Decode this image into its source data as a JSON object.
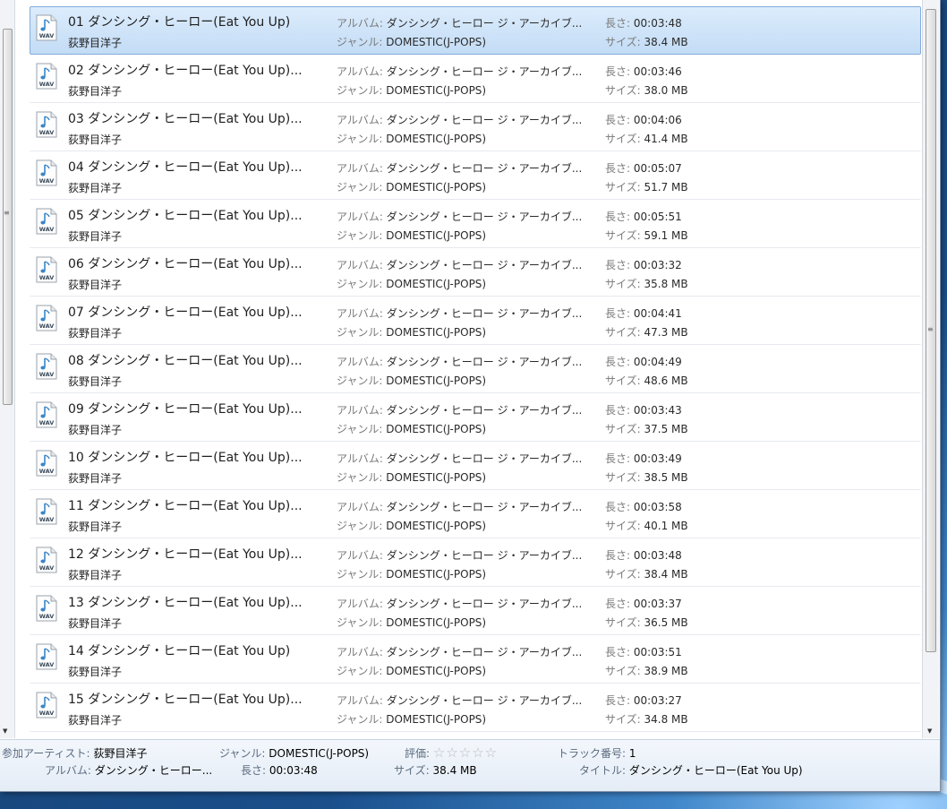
{
  "labels": {
    "album": "アルバム:",
    "genre": "ジャンル:",
    "length": "長さ:",
    "size": "サイズ:"
  },
  "file_icon_text": "WAV",
  "tracks": [
    {
      "title": "01 ダンシング・ヒーロー(Eat You Up)",
      "artist": "荻野目洋子",
      "album": "ダンシング・ヒーロー ジ・アーカイブ...",
      "genre": "DOMESTIC(J-POPS)",
      "length": "00:03:48",
      "size": "38.4 MB",
      "selected": true
    },
    {
      "title": "02 ダンシング・ヒーロー(Eat You Up)...",
      "artist": "荻野目洋子",
      "album": "ダンシング・ヒーロー ジ・アーカイブ...",
      "genre": "DOMESTIC(J-POPS)",
      "length": "00:03:46",
      "size": "38.0 MB"
    },
    {
      "title": "03 ダンシング・ヒーロー(Eat You Up)...",
      "artist": "荻野目洋子",
      "album": "ダンシング・ヒーロー ジ・アーカイブ...",
      "genre": "DOMESTIC(J-POPS)",
      "length": "00:04:06",
      "size": "41.4 MB"
    },
    {
      "title": "04 ダンシング・ヒーロー(Eat You Up)...",
      "artist": "荻野目洋子",
      "album": "ダンシング・ヒーロー ジ・アーカイブ...",
      "genre": "DOMESTIC(J-POPS)",
      "length": "00:05:07",
      "size": "51.7 MB"
    },
    {
      "title": "05 ダンシング・ヒーロー(Eat You Up)...",
      "artist": "荻野目洋子",
      "album": "ダンシング・ヒーロー ジ・アーカイブ...",
      "genre": "DOMESTIC(J-POPS)",
      "length": "00:05:51",
      "size": "59.1 MB"
    },
    {
      "title": "06 ダンシング・ヒーロー(Eat You Up)...",
      "artist": "荻野目洋子",
      "album": "ダンシング・ヒーロー ジ・アーカイブ...",
      "genre": "DOMESTIC(J-POPS)",
      "length": "00:03:32",
      "size": "35.8 MB"
    },
    {
      "title": "07 ダンシング・ヒーロー(Eat You Up)...",
      "artist": "荻野目洋子",
      "album": "ダンシング・ヒーロー ジ・アーカイブ...",
      "genre": "DOMESTIC(J-POPS)",
      "length": "00:04:41",
      "size": "47.3 MB"
    },
    {
      "title": "08 ダンシング・ヒーロー(Eat You Up)...",
      "artist": "荻野目洋子",
      "album": "ダンシング・ヒーロー ジ・アーカイブ...",
      "genre": "DOMESTIC(J-POPS)",
      "length": "00:04:49",
      "size": "48.6 MB"
    },
    {
      "title": "09 ダンシング・ヒーロー(Eat You Up)...",
      "artist": "荻野目洋子",
      "album": "ダンシング・ヒーロー ジ・アーカイブ...",
      "genre": "DOMESTIC(J-POPS)",
      "length": "00:03:43",
      "size": "37.5 MB"
    },
    {
      "title": "10 ダンシング・ヒーロー(Eat You Up)...",
      "artist": "荻野目洋子",
      "album": "ダンシング・ヒーロー ジ・アーカイブ...",
      "genre": "DOMESTIC(J-POPS)",
      "length": "00:03:49",
      "size": "38.5 MB"
    },
    {
      "title": "11 ダンシング・ヒーロー(Eat You Up)...",
      "artist": "荻野目洋子",
      "album": "ダンシング・ヒーロー ジ・アーカイブ...",
      "genre": "DOMESTIC(J-POPS)",
      "length": "00:03:58",
      "size": "40.1 MB"
    },
    {
      "title": "12 ダンシング・ヒーロー(Eat You Up)...",
      "artist": "荻野目洋子",
      "album": "ダンシング・ヒーロー ジ・アーカイブ...",
      "genre": "DOMESTIC(J-POPS)",
      "length": "00:03:48",
      "size": "38.4 MB"
    },
    {
      "title": "13 ダンシング・ヒーロー(Eat You Up)...",
      "artist": "荻野目洋子",
      "album": "ダンシング・ヒーロー ジ・アーカイブ...",
      "genre": "DOMESTIC(J-POPS)",
      "length": "00:03:37",
      "size": "36.5 MB"
    },
    {
      "title": "14 ダンシング・ヒーロー(Eat You Up)",
      "artist": "荻野目洋子",
      "album": "ダンシング・ヒーロー ジ・アーカイブ...",
      "genre": "DOMESTIC(J-POPS)",
      "length": "00:03:51",
      "size": "38.9 MB"
    },
    {
      "title": "15 ダンシング・ヒーロー(Eat You Up)...",
      "artist": "荻野目洋子",
      "album": "ダンシング・ヒーロー ジ・アーカイブ...",
      "genre": "DOMESTIC(J-POPS)",
      "length": "00:03:27",
      "size": "34.8 MB"
    }
  ],
  "details": {
    "contributing_artist_label": "参加アーティスト:",
    "contributing_artist": "荻野目洋子",
    "genre_label": "ジャンル:",
    "genre": "DOMESTIC(J-POPS)",
    "rating_label": "評価:",
    "rating_stars": "☆☆☆☆☆",
    "track_number_label": "トラック番号:",
    "track_number": "1",
    "album_label": "アルバム:",
    "album": "ダンシング・ヒーロー...",
    "length_label": "長さ:",
    "length": "00:03:48",
    "size_label": "サイズ:",
    "size": "38.4 MB",
    "title_label": "タイトル:",
    "title": "ダンシング・ヒーロー(Eat You Up)"
  },
  "colors": {
    "selection": "#c3dcf5",
    "selection_border": "#84acdd",
    "wav_note": "#3a86c8"
  }
}
